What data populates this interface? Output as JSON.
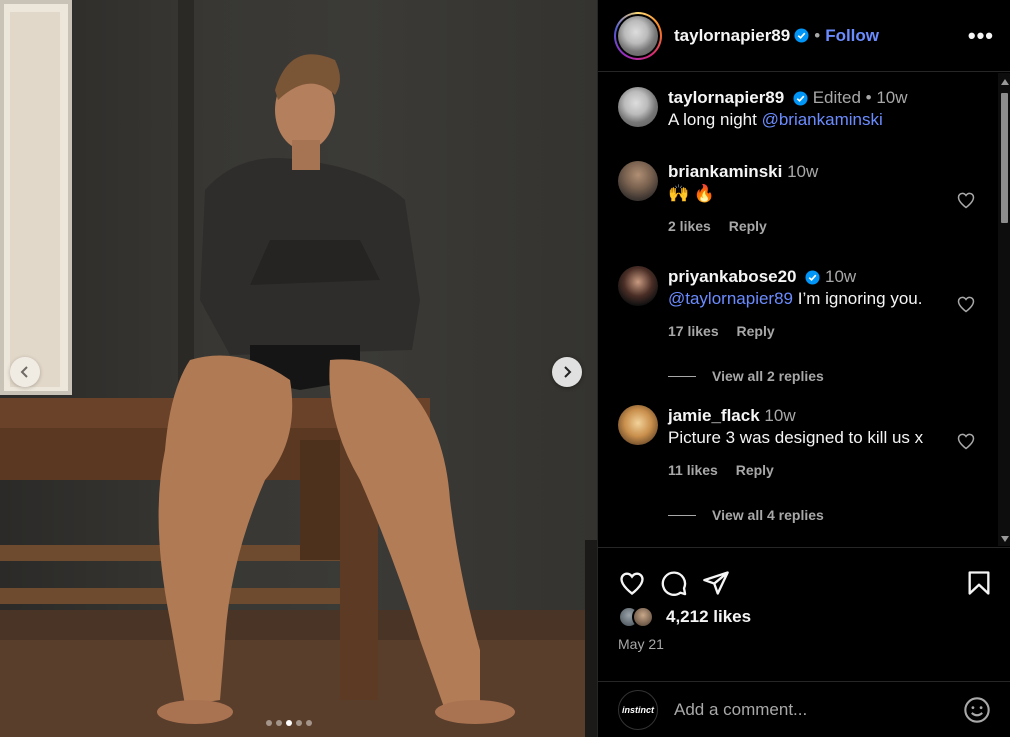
{
  "header": {
    "username": "taylornapier89",
    "separator": "•",
    "follow_label": "Follow",
    "more_label": "•••"
  },
  "caption": {
    "username": "taylornapier89",
    "edited": "Edited",
    "dot": "•",
    "time": "10w",
    "text": "A long night ",
    "mention": "@briankaminski"
  },
  "comments": [
    {
      "username": "briankaminski",
      "time": "10w",
      "text": "🙌 🔥",
      "likes": "2 likes",
      "reply": "Reply"
    },
    {
      "username": "priyankabose20",
      "time": "10w",
      "mention": "@taylornapier89",
      "text": " I’m ignoring you.",
      "likes": "17 likes",
      "reply": "Reply",
      "view_replies": "View all 2 replies"
    },
    {
      "username": "jamie_flack",
      "time": "10w",
      "text": "Picture 3 was designed to kill us x",
      "likes": "11 likes",
      "reply": "Reply",
      "view_replies": "View all 4 replies"
    }
  ],
  "post": {
    "likes": "4,212 likes",
    "date": "May 21",
    "add_comment_placeholder": "Add a comment...",
    "commenter_avatar_text": "instinct"
  },
  "carousel": {
    "total_images": 5,
    "active_index": 2
  },
  "icons": {
    "like": "heart-icon",
    "comment": "comment-icon",
    "share": "share-icon",
    "save": "bookmark-icon",
    "verified": "verified-badge-icon",
    "emoji": "emoji-icon"
  },
  "colors": {
    "link": "#6b8cff",
    "verified": "#0095f6",
    "muted": "#a8a8a8"
  }
}
